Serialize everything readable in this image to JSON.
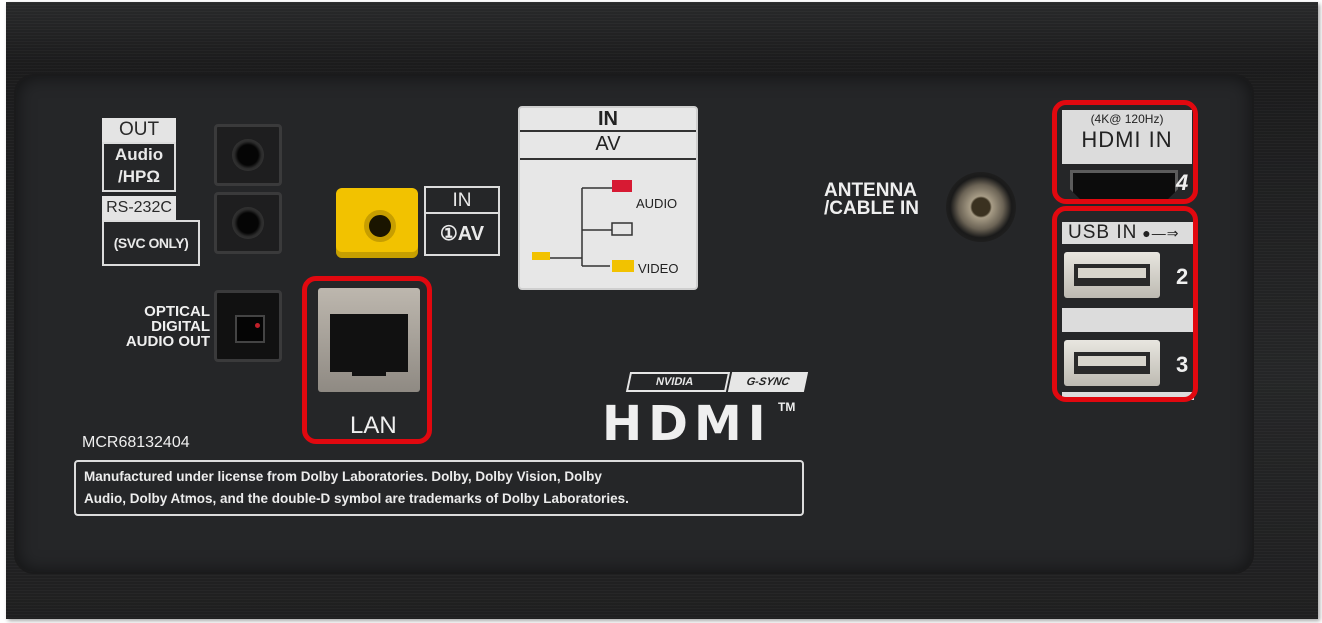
{
  "panel": {
    "out_label": "OUT",
    "audio_hp_label_1": "Audio",
    "audio_hp_label_2": "/HPΩ",
    "rs232_label": "RS-232C",
    "svc_label": "(SVC ONLY)",
    "optical_label_1": "OPTICAL",
    "optical_label_2": "DIGITAL",
    "optical_label_3": "AUDIO OUT",
    "small_in_label": "IN",
    "small_av_label": "①AV",
    "in_av_title": "IN",
    "in_av_sub": "AV",
    "audio_label": "AUDIO",
    "video_label": "VIDEO",
    "lan_label": "LAN",
    "antenna_label_1": "ANTENNA",
    "antenna_label_2": "/CABLE IN",
    "hdmi_spec": "(4K@ 120Hz)",
    "hdmi_in_label": "HDMI IN",
    "hdmi_num": "4",
    "usb_in_label": "USB IN",
    "usb_num_2": "2",
    "usb_num_3": "3",
    "model_code": "MCR68132404",
    "nvidia_label": "NVIDIA",
    "gsync_label": "G-SYNC",
    "hdmi_logo": "HDMI",
    "tm": "TM",
    "dolby_line_1": "Manufactured under license from Dolby Laboratories. Dolby, Dolby Vision, Dolby",
    "dolby_line_2": "Audio, Dolby Atmos, and the double-D symbol are trademarks of Dolby Laboratories."
  },
  "colors": {
    "highlight": "#e1080f",
    "composite_yellow": "#f2c200",
    "audio_red": "#d71a33"
  }
}
